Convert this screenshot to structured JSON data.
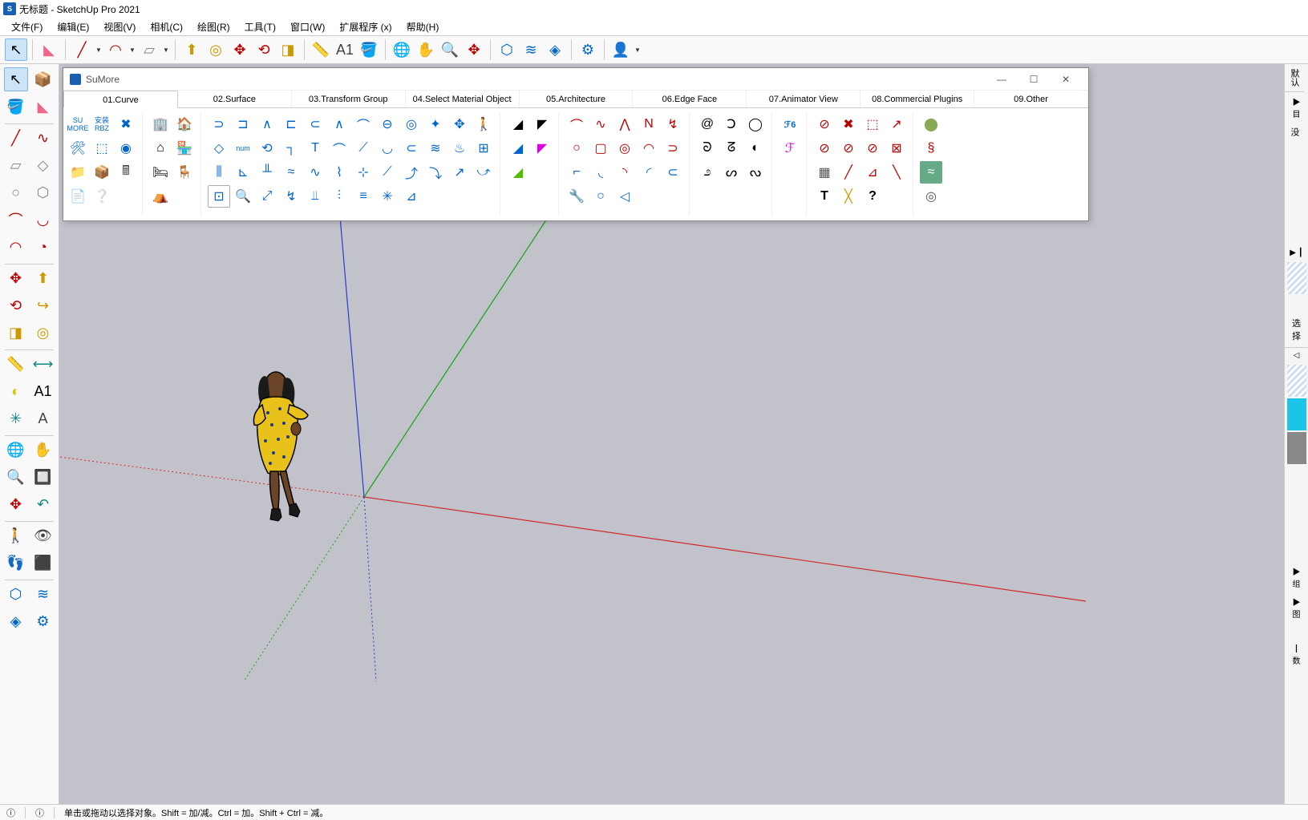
{
  "window": {
    "title": "无标题 - SketchUp Pro 2021"
  },
  "menu": {
    "file": "文件(F)",
    "edit": "编辑(E)",
    "view": "视图(V)",
    "camera": "相机(C)",
    "draw": "绘图(R)",
    "tools": "工具(T)",
    "window": "窗口(W)",
    "extensions": "扩展程序 (x)",
    "help": "帮助(H)"
  },
  "sumore": {
    "title": "SuMore",
    "tabs": [
      "01.Curve",
      "02.Surface",
      "03.Transform Group",
      "04.Select Material Object",
      "05.Architecture",
      "06.Edge Face",
      "07.Animator View",
      "08.Commercial Plugins",
      "09.Other"
    ],
    "group1_labels": {
      "su_more": "SU MORE",
      "install": "安装 RBZ"
    }
  },
  "right_panel": {
    "tab1": "默认",
    "tab2": "▶ 目",
    "tab3": "没",
    "arrow": "▶ ┃",
    "select_label": "选择",
    "sub_arrow": "◁",
    "list1": "▶ 组",
    "list2": "▶ 图",
    "last": "┃ 数"
  },
  "status": {
    "hint": "单击或拖动以选择对象。Shift = 加/减。Ctrl = 加。Shift + Ctrl = 减。"
  },
  "colors": {
    "axis_red": "#d12a2a",
    "axis_green": "#18a018",
    "axis_blue": "#2a3ad1"
  }
}
